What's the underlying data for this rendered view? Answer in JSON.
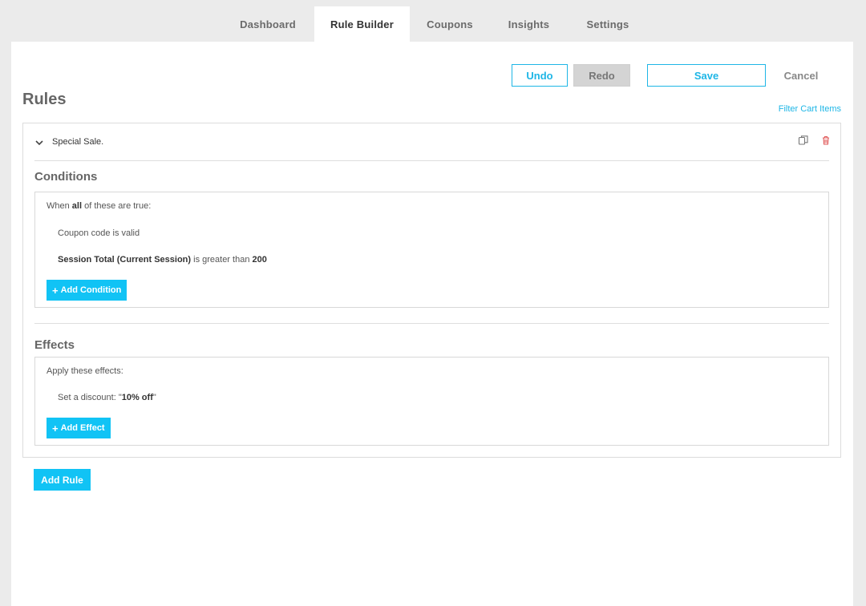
{
  "tabs": [
    {
      "label": "Dashboard",
      "active": false
    },
    {
      "label": "Rule Builder",
      "active": true
    },
    {
      "label": "Coupons",
      "active": false
    },
    {
      "label": "Insights",
      "active": false
    },
    {
      "label": "Settings",
      "active": false
    }
  ],
  "toolbar": {
    "undo_label": "Undo",
    "redo_label": "Redo",
    "save_label": "Save",
    "cancel_label": "Cancel"
  },
  "page": {
    "title": "Rules",
    "filter_link": "Filter Cart Items"
  },
  "rule": {
    "name": "Special Sale.",
    "icons": [
      "chevron-down-icon",
      "copy-icon",
      "trash-icon"
    ],
    "conditions": {
      "title": "Conditions",
      "intro_prefix": "When ",
      "intro_bold": "all",
      "intro_suffix": " of these are true:",
      "items": [
        {
          "text": "Coupon code is valid"
        },
        {
          "bold_a": "Session Total (Current Session)",
          "middle": " is greater than ",
          "bold_b": "200"
        }
      ],
      "add_label": "Add Condition"
    },
    "effects": {
      "title": "Effects",
      "intro": "Apply these effects:",
      "item_prefix": "Set a discount: \"",
      "item_bold": "10% off",
      "item_suffix": "\"",
      "add_label": "Add Effect"
    }
  },
  "add_rule_label": "Add Rule",
  "colors": {
    "accent": "#11c3f5",
    "link": "#1eb6e6",
    "danger": "#e05a5a"
  }
}
